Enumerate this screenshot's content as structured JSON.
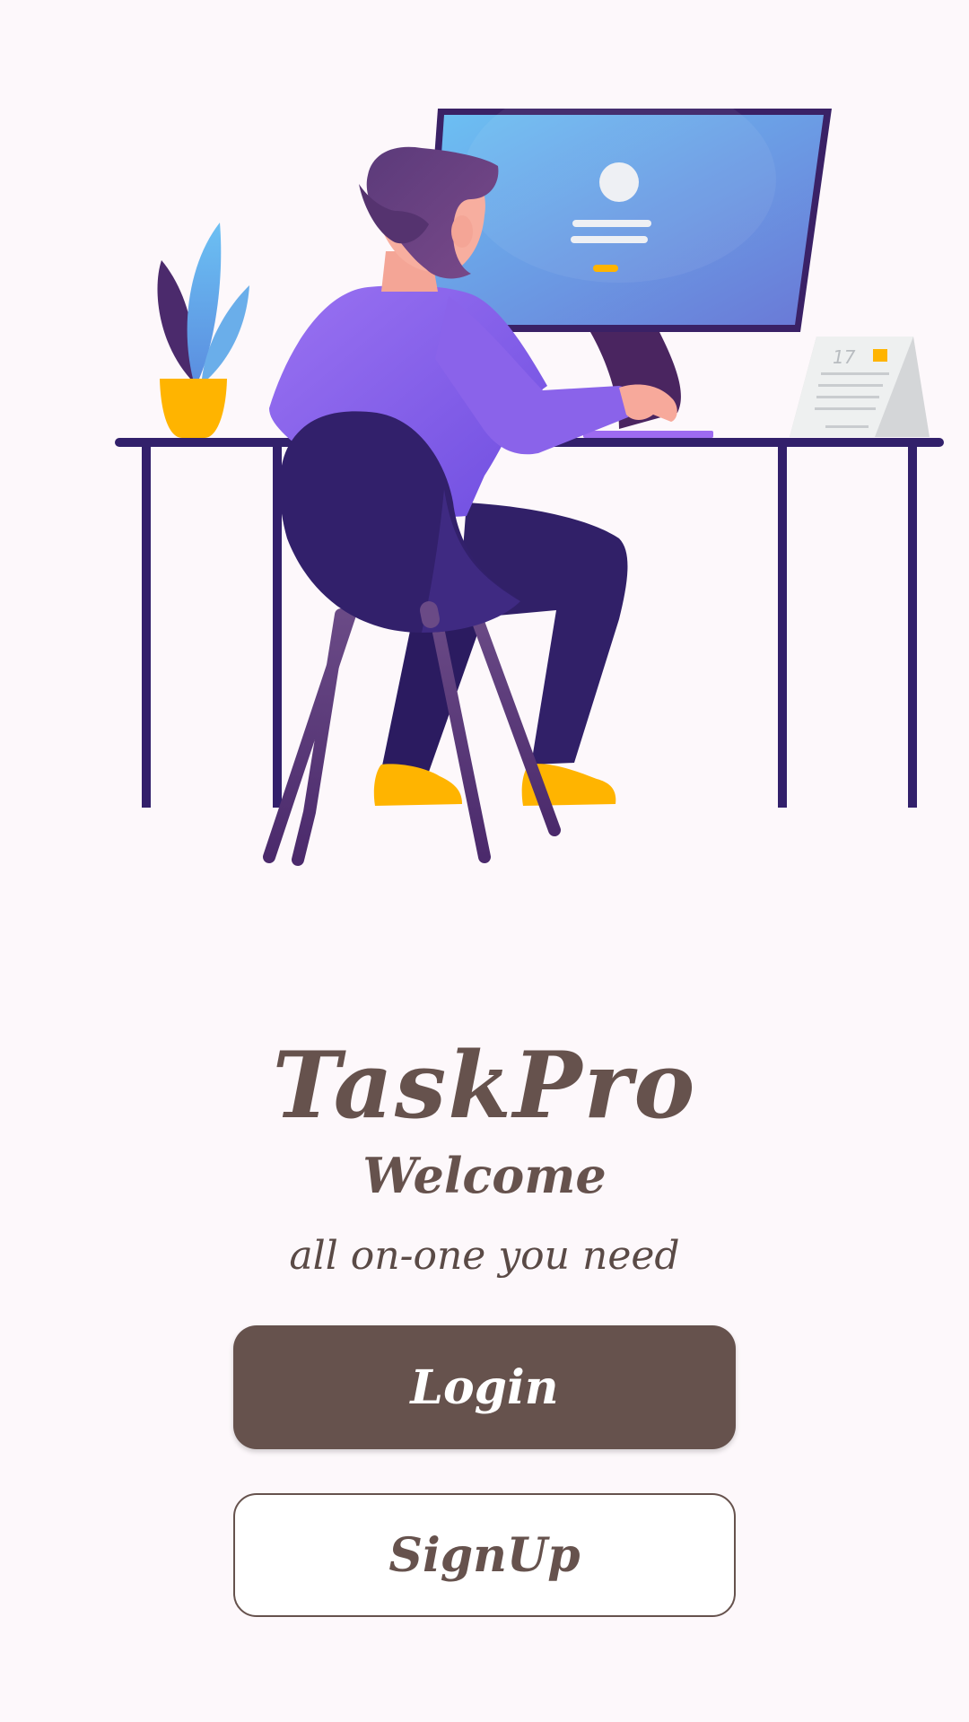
{
  "app": {
    "title": "TaskPro",
    "welcome": "Welcome",
    "tagline": "all on-one you need"
  },
  "illustration": {
    "subject": "person working at desk with computer",
    "calendar_day": "17"
  },
  "actions": {
    "login_label": "Login",
    "signup_label": "SignUp"
  },
  "colors": {
    "background": "#fdf8fb",
    "brand_brown": "#66524d",
    "accent_yellow": "#ffb400",
    "desk_navy": "#32206b",
    "shirt_purple": "#8a63ea",
    "screen_blue": "#6aaeea"
  }
}
